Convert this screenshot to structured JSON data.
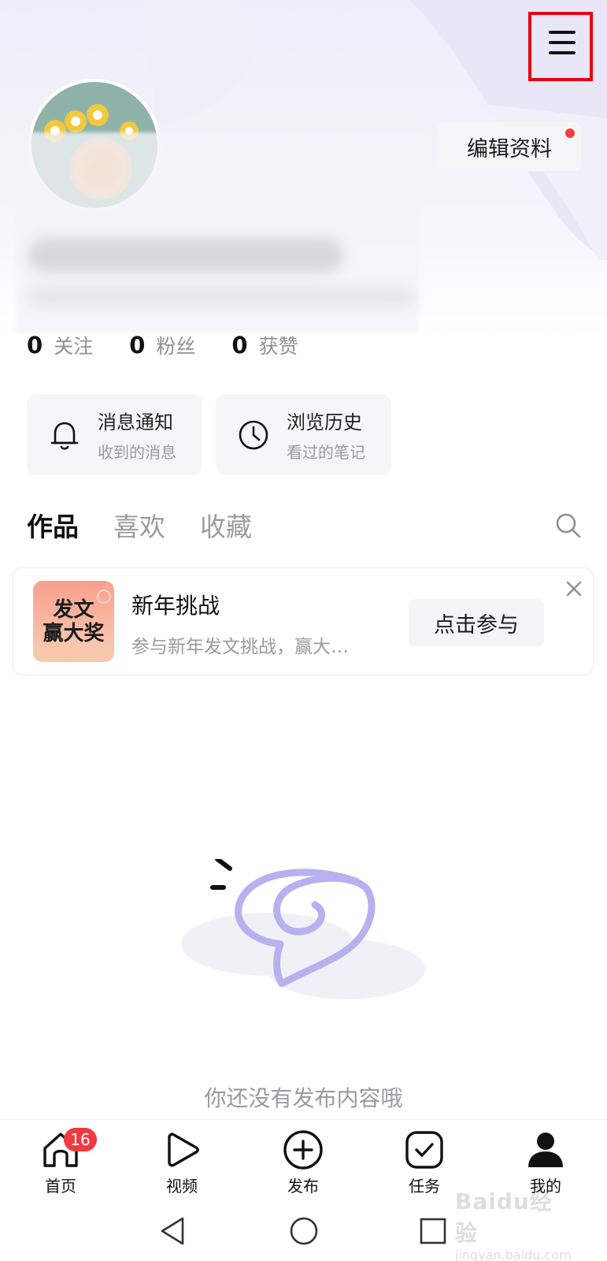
{
  "header": {
    "menu_icon": "hamburger-menu-icon",
    "edit_profile_label": "编辑资料",
    "edit_profile_dot_color": "#f13e3e",
    "highlight_color": "#e60012"
  },
  "stats": [
    {
      "value": "0",
      "label": "关注"
    },
    {
      "value": "0",
      "label": "粉丝"
    },
    {
      "value": "0",
      "label": "获赞"
    }
  ],
  "shortcuts": [
    {
      "title": "消息通知",
      "subtitle": "收到的消息",
      "icon": "bell-icon"
    },
    {
      "title": "浏览历史",
      "subtitle": "看过的笔记",
      "icon": "clock-icon"
    }
  ],
  "tabs": [
    {
      "label": "作品",
      "active": true
    },
    {
      "label": "喜欢",
      "active": false
    },
    {
      "label": "收藏",
      "active": false
    }
  ],
  "promo": {
    "image_line1": "发文",
    "image_line2": "赢大奖",
    "title": "新年挑战",
    "description": "参与新年发文挑战，赢大…",
    "cta_label": "点击参与"
  },
  "empty_state": {
    "message": "你还没有发布内容哦"
  },
  "bottom_nav": [
    {
      "label": "首页",
      "icon": "home-icon",
      "badge": "16"
    },
    {
      "label": "视频",
      "icon": "play-icon"
    },
    {
      "label": "发布",
      "icon": "plus-circle-icon"
    },
    {
      "label": "任务",
      "icon": "task-check-icon"
    },
    {
      "label": "我的",
      "icon": "user-icon"
    }
  ],
  "watermark": {
    "line1": "Baidu经验",
    "line2": "jingyan.baidu.com"
  },
  "colors": {
    "accent_purple": "#b8b0ef",
    "badge_red": "#f2393f"
  }
}
